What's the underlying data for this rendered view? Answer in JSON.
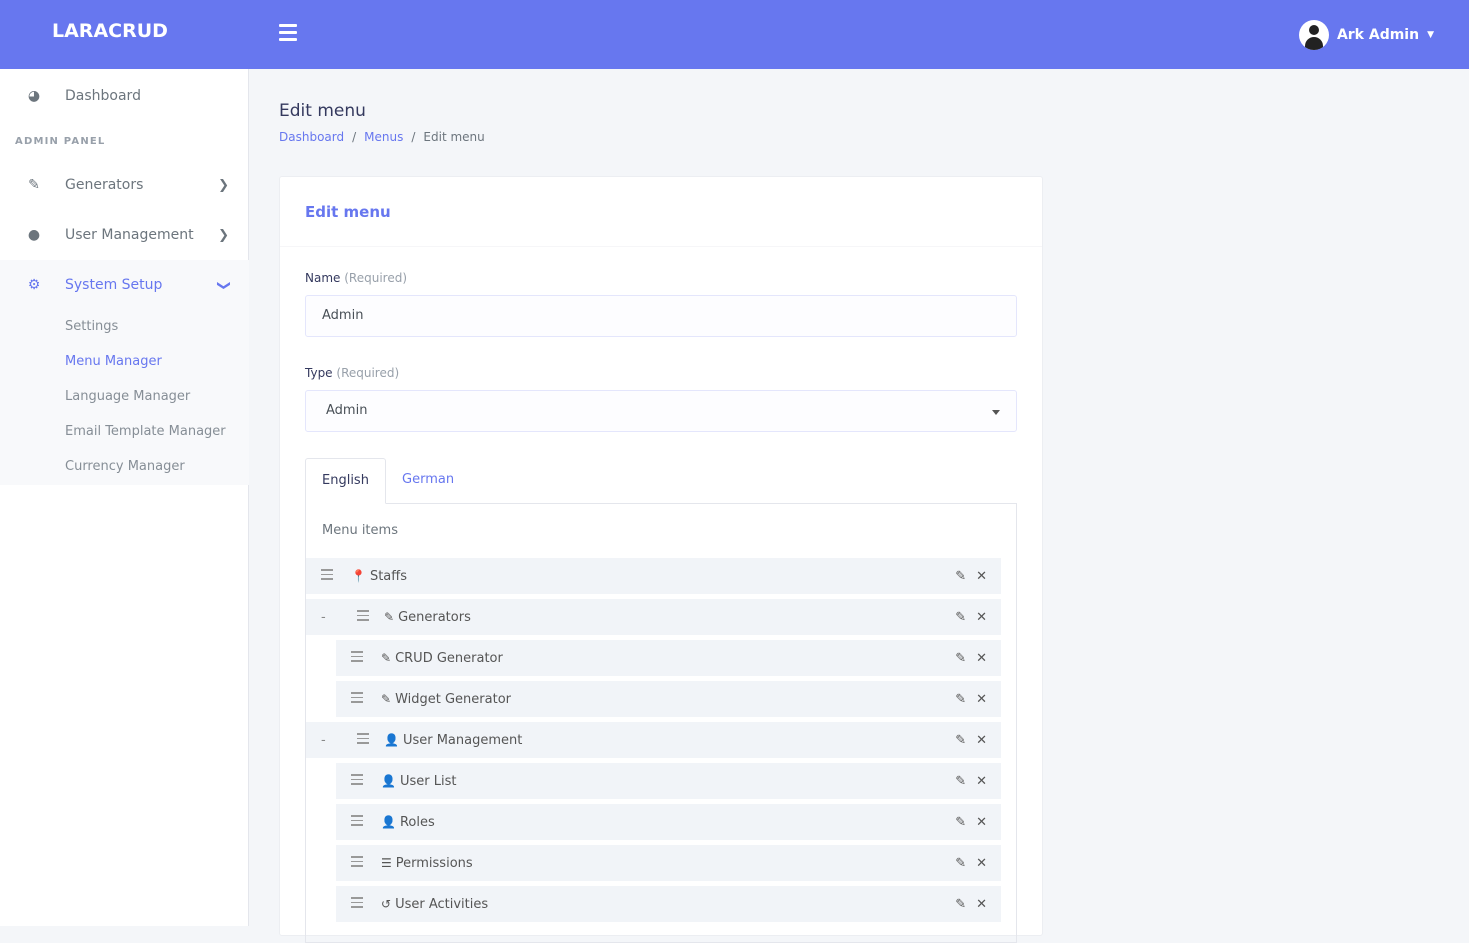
{
  "header": {
    "logo": "LARACRUD",
    "user": "Ark Admin"
  },
  "sidebar": {
    "dashboard": "Dashboard",
    "section": "ADMIN PANEL",
    "generators": "Generators",
    "user_management": "User Management",
    "system_setup": "System Setup",
    "sub": [
      "Settings",
      "Menu Manager",
      "Language Manager",
      "Email Template Manager",
      "Currency Manager"
    ]
  },
  "page": {
    "title": "Edit menu",
    "breadcrumb": [
      "Dashboard",
      "Menus",
      "Edit menu"
    ],
    "sep": "/"
  },
  "card": {
    "title": "Edit menu",
    "name_label": "Name",
    "type_label": "Type",
    "required": "(Required)",
    "name_value": "Admin",
    "type_value": "Admin",
    "tabs": [
      "English",
      "German"
    ],
    "menu_items_label": "Menu items",
    "items": [
      {
        "label": "Staffs",
        "icon": "📍"
      },
      {
        "label": "Generators",
        "icon": "✎"
      },
      {
        "label": "CRUD Generator",
        "icon": "✎"
      },
      {
        "label": "Widget Generator",
        "icon": "✎"
      },
      {
        "label": "User Management",
        "icon": "👤"
      },
      {
        "label": "User List",
        "icon": "👤"
      },
      {
        "label": "Roles",
        "icon": "👤"
      },
      {
        "label": "Permissions",
        "icon": "☰"
      },
      {
        "label": "User Activities",
        "icon": "↺"
      }
    ],
    "collapse": "-",
    "edit": "✎",
    "delete": "✕"
  }
}
